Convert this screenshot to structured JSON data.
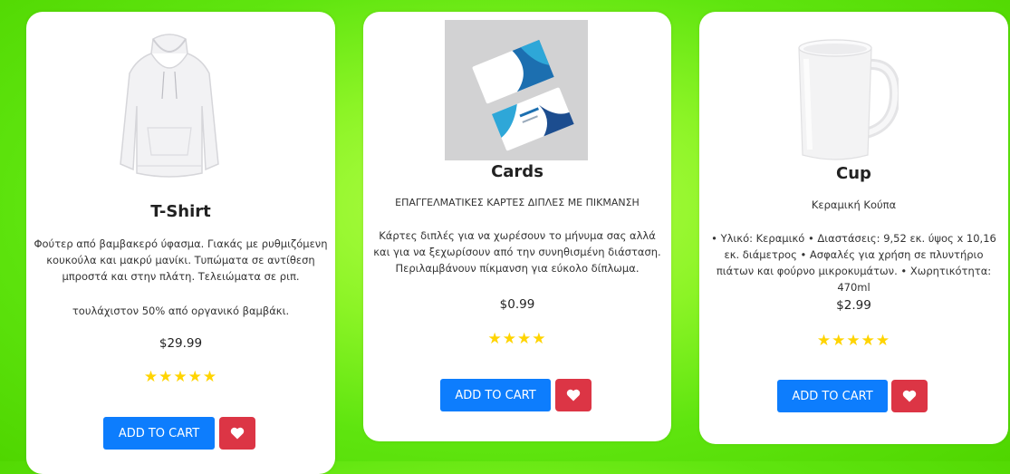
{
  "colors": {
    "accent_blue": "#0d7dfd",
    "heart_red": "#dc3545",
    "star_yellow": "#ffd400",
    "background_green": "#7cee1e"
  },
  "products": [
    {
      "title": "T-Shirt",
      "description": "Φούτερ από βαμβακερό ύφασμα. Γιακάς με ρυθμιζόμενη κουκούλα και μακρύ μανίκι. Τυπώματα σε αντίθεση μπροστά και στην πλάτη. Τελειώματα σε ριπ.",
      "extra": "τουλάχιστον 50% από οργανικό βαμβάκι.",
      "price": "$29.99",
      "stars": "★★★★★",
      "rating": 5,
      "add_to_cart": "ADD TO CART",
      "icon": "heart-icon"
    },
    {
      "title": "Cards",
      "subtitle": "ΕΠΑΓΓΕΛΜΑΤΙΚΕΣ ΚΑΡΤΕΣ ΔΙΠΛΕΣ ΜΕ ΠΙΚΜΑΝΣΗ",
      "description": "Κάρτες διπλές για να χωρέσουν το μήνυμα σας αλλά και για να ξεχωρίσουν από την συνηθισμένη διάσταση. Περιλαμβάνουν πίκμανση για εύκολο δίπλωμα.",
      "price": "$0.99",
      "stars": "★★★★",
      "rating": 4,
      "add_to_cart": "ADD TO CART",
      "icon": "heart-icon"
    },
    {
      "title": "Cup",
      "subtitle": "Κεραμική Κούπα",
      "description": "• Υλικό: Κεραμικό • Διαστάσεις: 9,52 εκ. ύψος x 10,16 εκ. διάμετρος • Ασφαλές για χρήση σε πλυντήριο πιάτων και φούρνο μικροκυμάτων. • Χωρητικότητα: 470ml",
      "price": "$2.99",
      "stars": "★★★★★",
      "rating": 5,
      "add_to_cart": "ADD TO CART",
      "icon": "heart-icon"
    }
  ]
}
